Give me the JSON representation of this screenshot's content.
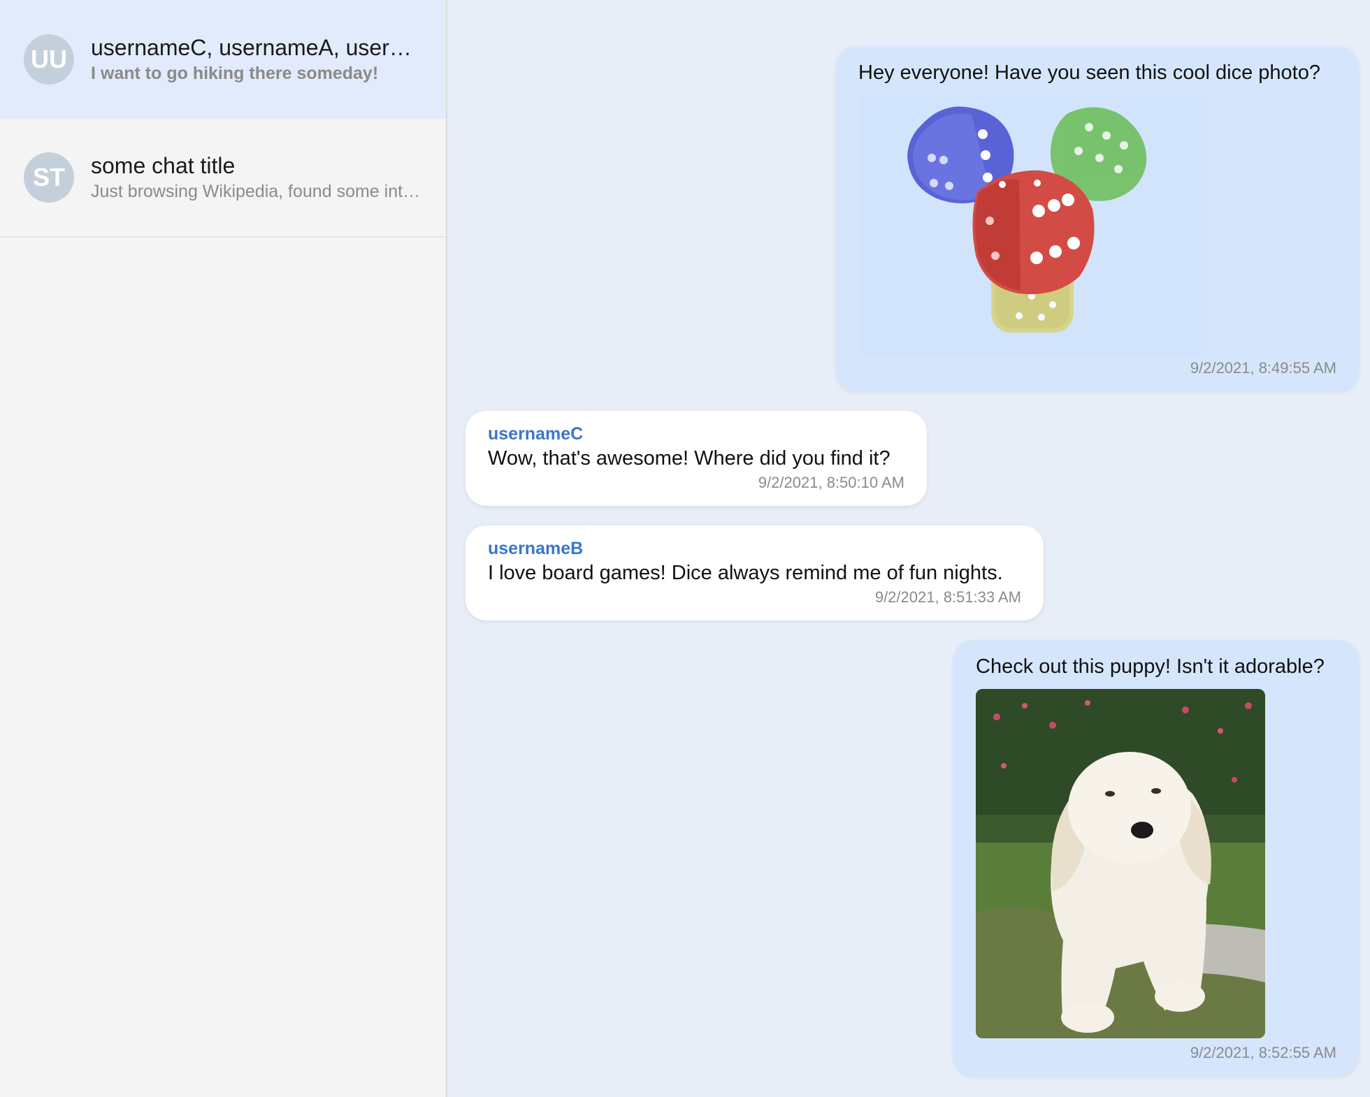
{
  "sidebar": {
    "chats": [
      {
        "initials": "UU",
        "title": "usernameC, usernameA, usernameB",
        "preview": "I want to go hiking there someday!",
        "active": true
      },
      {
        "initials": "ST",
        "title": "some chat title",
        "preview": "Just browsing Wikipedia, found some interesting photos",
        "active": false
      }
    ]
  },
  "messages": [
    {
      "mine": true,
      "text": "Hey everyone! Have you seen this cool dice photo?",
      "image": "dice-image",
      "time": "9/2/2021, 8:49:55 AM"
    },
    {
      "mine": false,
      "sender": "usernameC",
      "text": "Wow, that's awesome! Where did you find it?",
      "time": "9/2/2021, 8:50:10 AM"
    },
    {
      "mine": false,
      "sender": "usernameB",
      "text": "I love board games! Dice always remind me of fun nights.",
      "time": "9/2/2021, 8:51:33 AM"
    },
    {
      "mine": true,
      "text": "Check out this puppy! Isn't it adorable?",
      "image": "puppy-image",
      "time": "9/2/2021, 8:52:55 AM"
    }
  ],
  "colors": {
    "sender_name": "#3a76c9",
    "own_bubble": "#d5e6fc",
    "other_bubble": "#ffffff",
    "active_chat": "#e2ebfb",
    "background": "#e8eef8"
  }
}
